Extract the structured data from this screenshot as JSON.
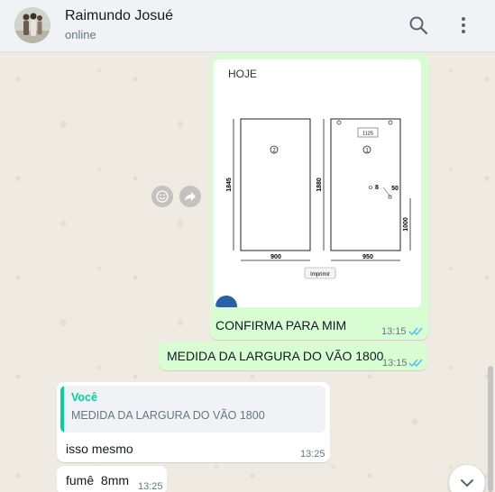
{
  "header": {
    "contact_name": "Raimundo Josué",
    "status": "online",
    "search_icon": "search-icon",
    "menu_icon": "kebab-menu-icon"
  },
  "messages": {
    "image": {
      "hoje_label": "HOJE",
      "panel_left": {
        "number": "2",
        "height": "1845",
        "width": "900"
      },
      "panel_right": {
        "number": "1",
        "height": "1880",
        "width": "950",
        "top_label": "1125",
        "hole_label": "8",
        "offset_label": "50",
        "handle_height": "1000"
      },
      "print_button": "Imprimir"
    },
    "caption": {
      "text": "CONFIRMA PARA MIM",
      "time": "13:15"
    },
    "out2": {
      "text": "MEDIDA DA LARGURA DO VÃO 1800",
      "time": "13:15"
    },
    "reply": {
      "quote_author": "Você",
      "quote_text": "MEDIDA DA LARGURA DO VÃO 1800",
      "text": "isso mesmo",
      "time": "13:25"
    },
    "in2": {
      "text": "fumê  8mm",
      "time": "13:25"
    }
  },
  "colors": {
    "outgoing_bubble": "#d9fdd3",
    "incoming_bubble": "#ffffff",
    "read_ticks": "#53bdeb",
    "quote_accent": "#06cf9c",
    "chat_background": "#efeae2"
  }
}
